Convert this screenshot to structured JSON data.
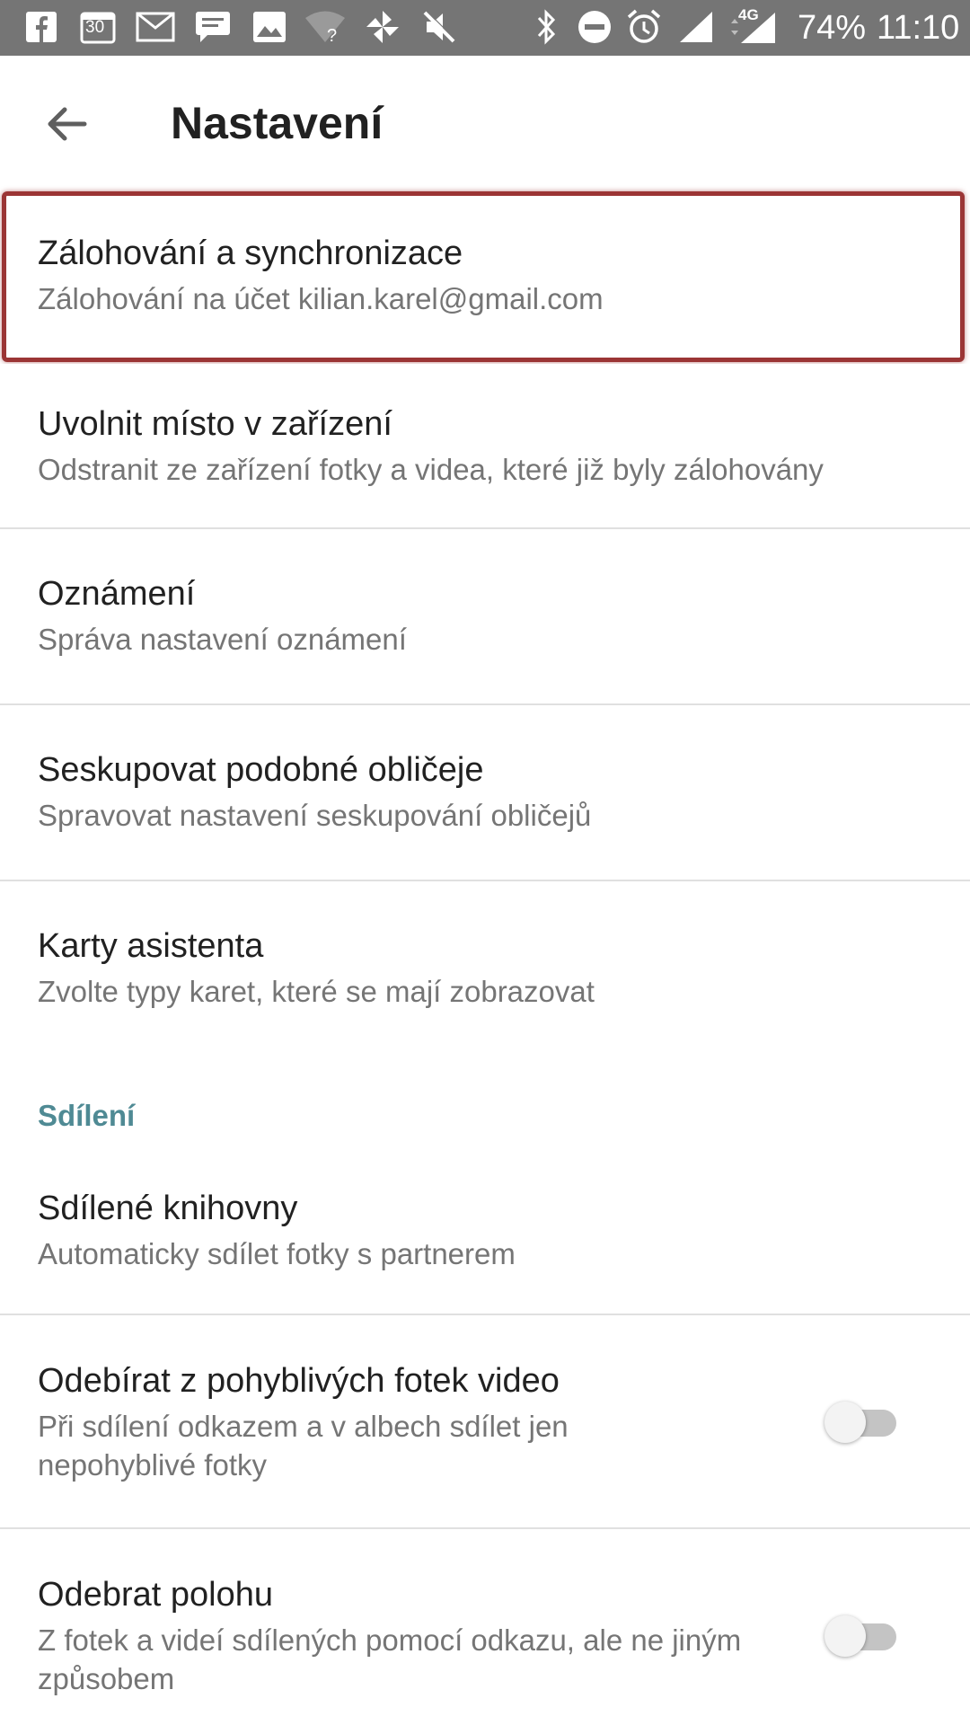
{
  "status_bar": {
    "battery": "74%",
    "time": "11:10",
    "network_label": "4G",
    "calendar_day": "30",
    "icons": [
      "facebook-icon",
      "calendar-icon",
      "gmail-icon",
      "message-icon",
      "gallery-icon",
      "wifi-icon",
      "pinwheel-icon",
      "mute-icon",
      "bluetooth-icon",
      "dnd-icon",
      "alarm-icon",
      "signal-icon",
      "signal-4g-icon"
    ]
  },
  "appbar": {
    "title": "Nastavení",
    "back_icon": "arrow-back-icon"
  },
  "settings": [
    {
      "title": "Zálohování a synchronizace",
      "subtitle": "Zálohování na účet kilian.karel@gmail.com"
    },
    {
      "title": "Uvolnit místo v zařízení",
      "subtitle": "Odstranit ze zařízení fotky a videa, které již byly zálohovány"
    },
    {
      "title": "Oznámení",
      "subtitle": "Správa nastavení oznámení"
    },
    {
      "title": "Seskupovat podobné obličeje",
      "subtitle": "Spravovat nastavení seskupování obličejů"
    },
    {
      "title": "Karty asistenta",
      "subtitle": "Zvolte typy karet, které se mají zobrazovat"
    }
  ],
  "sharing_section": {
    "header": "Sdílení",
    "items": [
      {
        "title": "Sdílené knihovny",
        "subtitle": "Automaticky sdílet fotky s partnerem"
      },
      {
        "title": "Odebírat z pohyblivých fotek video",
        "subtitle": "Při sdílení odkazem a v albech sdílet jen nepohyblivé fotky",
        "toggle_on": false
      },
      {
        "title": "Odebrat polohu",
        "subtitle": "Z fotek a videí sdílených pomocí odkazu, ale ne jiným způsobem",
        "toggle_on": false
      }
    ]
  },
  "colors": {
    "status_bar": "#757575",
    "highlight_border": "#9b3535",
    "section_header": "#4f8a94"
  }
}
